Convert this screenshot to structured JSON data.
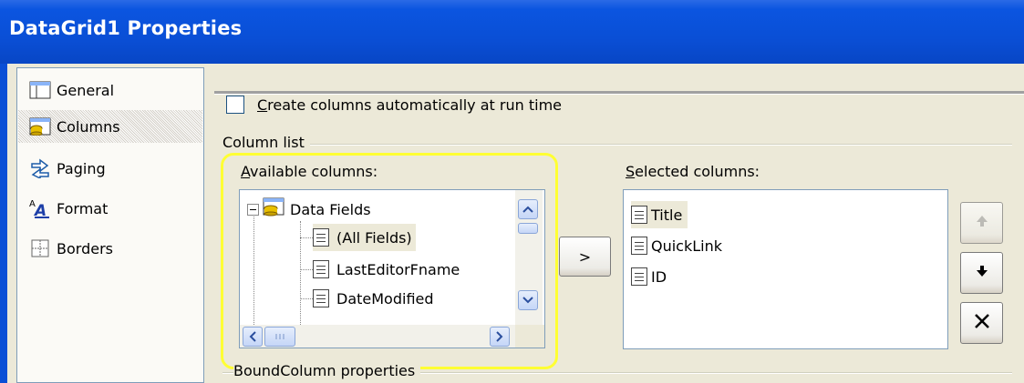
{
  "window": {
    "title": "DataGrid1 Properties"
  },
  "nav": {
    "items": [
      {
        "label": "General",
        "icon": "general-icon"
      },
      {
        "label": "Columns",
        "icon": "columns-icon"
      },
      {
        "label": "Paging",
        "icon": "paging-icon"
      },
      {
        "label": "Format",
        "icon": "format-icon"
      },
      {
        "label": "Borders",
        "icon": "borders-icon"
      }
    ],
    "selected": "Columns"
  },
  "options": {
    "auto_columns": {
      "first_letter": "C",
      "rest": "reate columns automatically at run time",
      "checked": false
    }
  },
  "column_list": {
    "label": "Column list",
    "available": {
      "label_first": "A",
      "label_rest": "vailable columns:",
      "tree_root": "Data Fields",
      "tree_items": [
        "(All Fields)",
        "LastEditorFname",
        "DateModified"
      ],
      "selected_item": "(All Fields)"
    },
    "add_button": ">",
    "selected": {
      "label_first": "S",
      "label_rest": "elected columns:",
      "items": [
        "Title",
        "QuickLink",
        "ID"
      ],
      "selected_item": "Title"
    }
  },
  "bound_column": {
    "label": "BoundColumn properties"
  },
  "colors": {
    "title_bar": "#0a4fd6",
    "highlight": "#ffff33",
    "face": "#ece9d8"
  }
}
